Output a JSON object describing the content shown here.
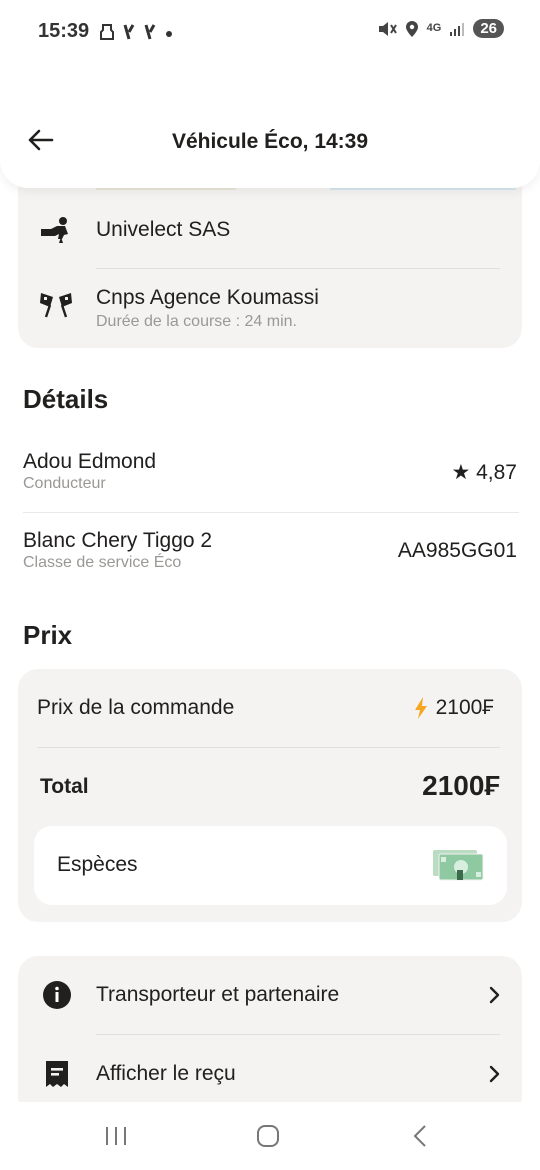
{
  "status_bar": {
    "time": "15:39",
    "left_icons": [
      "notification-icon",
      "carrier-y-icon",
      "carrier-y-icon",
      "dot-icon"
    ],
    "right_icons": [
      "mute-icon",
      "location-icon",
      "4g-icon",
      "signal-icon"
    ],
    "network": "4G",
    "battery": "26"
  },
  "header": {
    "title": "Véhicule Éco, 14:39"
  },
  "route": {
    "origin": "Univelect SAS",
    "destination": "Cnps Agence Koumassi",
    "duration": "Durée de la course : 24 min."
  },
  "details": {
    "title": "Détails",
    "driver_name": "Adou Edmond",
    "driver_role": "Conducteur",
    "rating": "★ 4,87",
    "car": "Blanc Chery Tiggo 2",
    "service_class": "Classe de service Éco",
    "plate": "AA985GG01"
  },
  "price": {
    "title": "Prix",
    "order_label": "Prix de la commande",
    "order_value": "2100₣",
    "total_label": "Total",
    "total_value": "2100₣",
    "payment_method": "Espèces"
  },
  "menu": {
    "items": [
      {
        "label": "Transporteur et partenaire",
        "icon": "info-icon"
      },
      {
        "label": "Afficher le reçu",
        "icon": "receipt-icon"
      }
    ]
  },
  "colors": {
    "accent": "#f5a623",
    "card_bg": "#f4f3f1",
    "text": "#21201f",
    "muted": "#9a9894"
  }
}
